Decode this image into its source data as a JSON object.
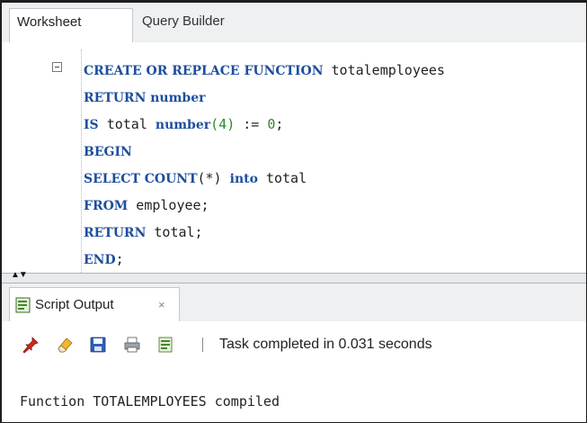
{
  "tabs": {
    "worksheet": "Worksheet",
    "query_builder": "Query Builder"
  },
  "editor": {
    "lines": [
      [
        {
          "t": "CREATE OR REPLACE FUNCTION",
          "c": "kw"
        },
        {
          "t": " totalemployees",
          "c": ""
        }
      ],
      [
        {
          "t": "RETURN number",
          "c": "kw"
        }
      ],
      [
        {
          "t": "IS",
          "c": "kw"
        },
        {
          "t": " total ",
          "c": ""
        },
        {
          "t": "number",
          "c": "kw"
        },
        {
          "t": "(4)",
          "c": "num"
        },
        {
          "t": " := ",
          "c": ""
        },
        {
          "t": "0",
          "c": "num"
        },
        {
          "t": ";",
          "c": ""
        }
      ],
      [
        {
          "t": "BEGIN",
          "c": "kw"
        }
      ],
      [
        {
          "t": "SELECT COUNT",
          "c": "kw"
        },
        {
          "t": "(*) ",
          "c": ""
        },
        {
          "t": "into",
          "c": "kw"
        },
        {
          "t": " total",
          "c": ""
        }
      ],
      [
        {
          "t": "FROM",
          "c": "kw"
        },
        {
          "t": " employee;",
          "c": ""
        }
      ],
      [
        {
          "t": "RETURN",
          "c": "kw"
        },
        {
          "t": " total;",
          "c": ""
        }
      ],
      [
        {
          "t": "END",
          "c": "kw"
        },
        {
          "t": ";",
          "c": ""
        }
      ]
    ]
  },
  "output_panel": {
    "tab_label": "Script Output",
    "close_glyph": "×",
    "status": "Task completed in 0.031 seconds",
    "output_text": "Function TOTALEMPLOYEES compiled",
    "toolbar_icons": [
      "pin-icon",
      "eraser-icon",
      "save-icon",
      "print-icon",
      "open-file-icon"
    ]
  },
  "colors": {
    "keyword": "#1e4e9c",
    "number": "#2a8a2a"
  }
}
